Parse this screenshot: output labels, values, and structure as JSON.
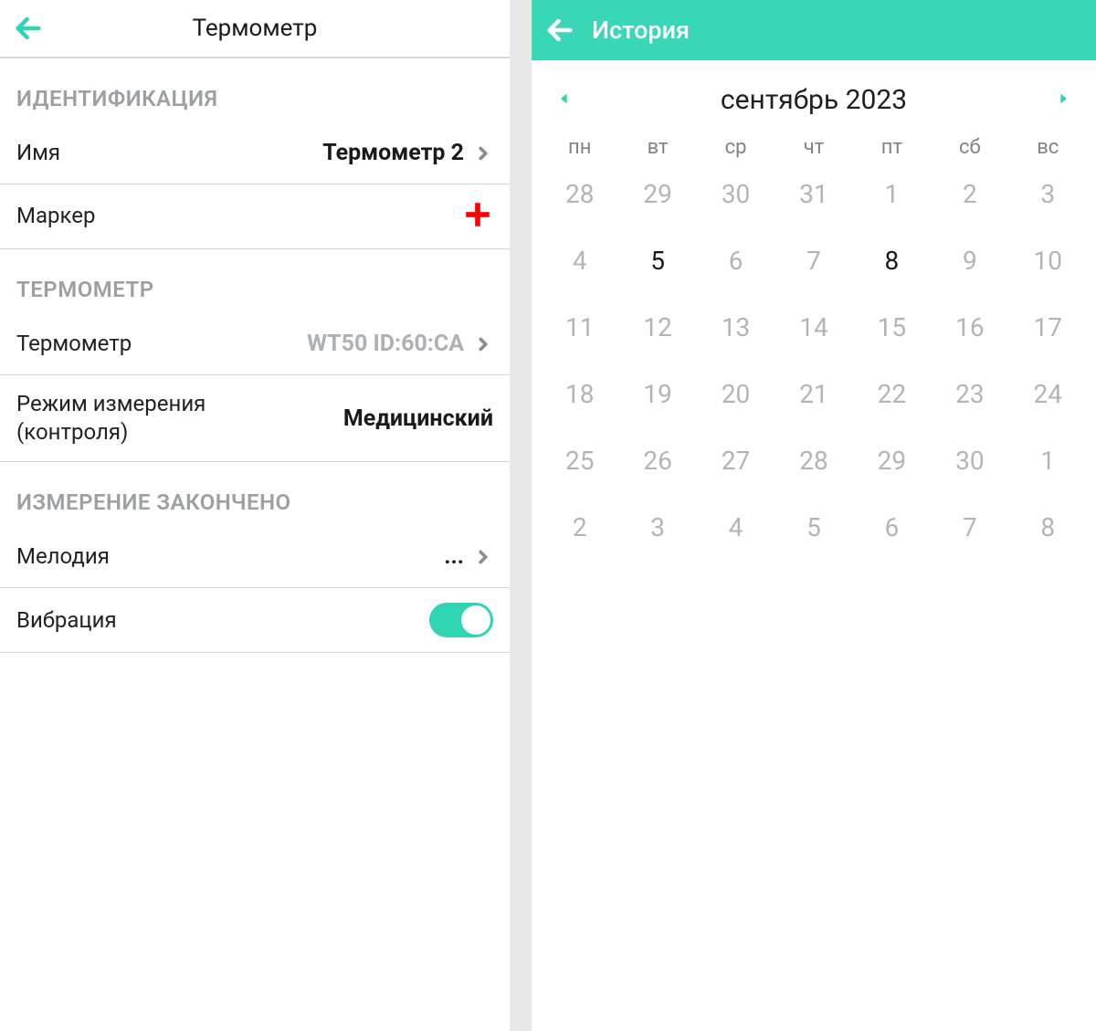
{
  "left": {
    "title": "Термометр",
    "sections": {
      "identification": {
        "header": "ИДЕНТИФИКАЦИЯ",
        "name_label": "Имя",
        "name_value": "Термометр 2",
        "marker_label": "Маркер"
      },
      "thermometer": {
        "header": "ТЕРМОМЕТР",
        "device_label": "Термометр",
        "device_value": "WT50  ID:60:CA",
        "mode_label": "Режим измерения (контроля)",
        "mode_value": "Медицинский"
      },
      "measurement_done": {
        "header": "ИЗМЕРЕНИЕ ЗАКОНЧЕНО",
        "melody_label": "Мелодия",
        "melody_value": "...",
        "vibration_label": "Вибрация",
        "vibration_on": true
      }
    }
  },
  "right": {
    "title": "История",
    "month_label": "сентябрь 2023",
    "weekdays": [
      "пн",
      "вт",
      "ср",
      "чт",
      "пт",
      "сб",
      "вс"
    ],
    "days": [
      {
        "n": 28,
        "active": false
      },
      {
        "n": 29,
        "active": false
      },
      {
        "n": 30,
        "active": false
      },
      {
        "n": 31,
        "active": false
      },
      {
        "n": 1,
        "active": false
      },
      {
        "n": 2,
        "active": false
      },
      {
        "n": 3,
        "active": false
      },
      {
        "n": 4,
        "active": false
      },
      {
        "n": 5,
        "active": true
      },
      {
        "n": 6,
        "active": false
      },
      {
        "n": 7,
        "active": false
      },
      {
        "n": 8,
        "active": true
      },
      {
        "n": 9,
        "active": false
      },
      {
        "n": 10,
        "active": false
      },
      {
        "n": 11,
        "active": false
      },
      {
        "n": 12,
        "active": false
      },
      {
        "n": 13,
        "active": false
      },
      {
        "n": 14,
        "active": false
      },
      {
        "n": 15,
        "active": false
      },
      {
        "n": 16,
        "active": false
      },
      {
        "n": 17,
        "active": false
      },
      {
        "n": 18,
        "active": false
      },
      {
        "n": 19,
        "active": false
      },
      {
        "n": 20,
        "active": false
      },
      {
        "n": 21,
        "active": false
      },
      {
        "n": 22,
        "active": false
      },
      {
        "n": 23,
        "active": false
      },
      {
        "n": 24,
        "active": false
      },
      {
        "n": 25,
        "active": false
      },
      {
        "n": 26,
        "active": false
      },
      {
        "n": 27,
        "active": false
      },
      {
        "n": 28,
        "active": false
      },
      {
        "n": 29,
        "active": false
      },
      {
        "n": 30,
        "active": false
      },
      {
        "n": 1,
        "active": false
      },
      {
        "n": 2,
        "active": false
      },
      {
        "n": 3,
        "active": false
      },
      {
        "n": 4,
        "active": false
      },
      {
        "n": 5,
        "active": false
      },
      {
        "n": 6,
        "active": false
      },
      {
        "n": 7,
        "active": false
      },
      {
        "n": 8,
        "active": false
      }
    ]
  },
  "colors": {
    "accent": "#2fd4b3",
    "header_bg": "#38d7b7",
    "red": "#ff0000"
  }
}
